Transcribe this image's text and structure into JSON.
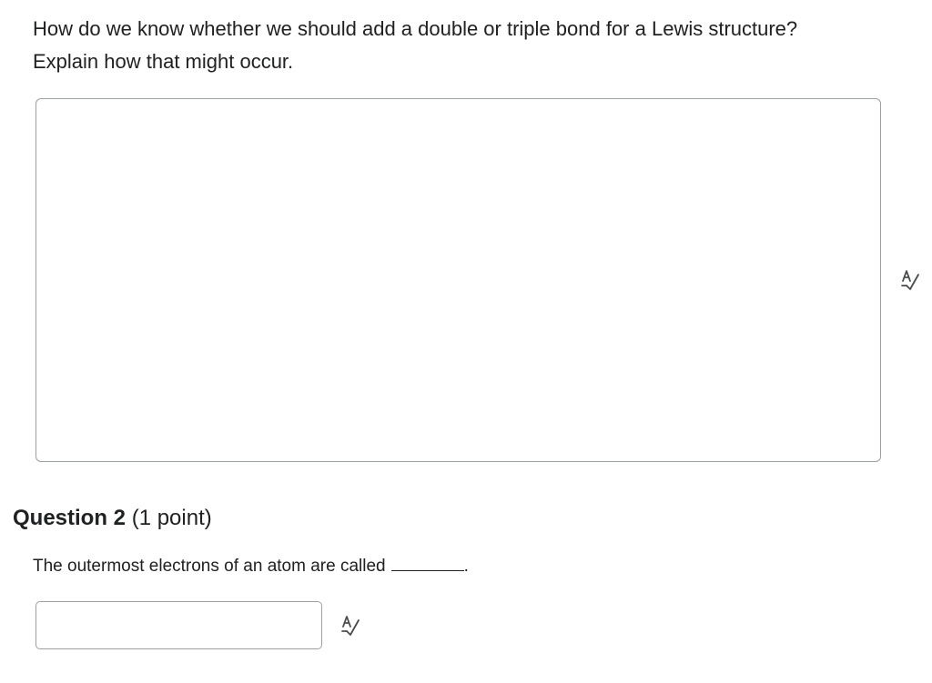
{
  "question1": {
    "prompt": "How do we know whether we should add a double or triple bond for a Lewis structure? Explain how that might occur.",
    "answer_value": ""
  },
  "question2": {
    "heading_label": "Question 2",
    "points_label": "(1 point)",
    "prompt": "The outermost electrons of an atom are called",
    "prompt_end": ".",
    "answer_value": ""
  },
  "icons": {
    "spellcheck": "spellcheck-icon"
  },
  "colors": {
    "text": "#202122",
    "border": "#9c9fa3",
    "icon": "#494c4e"
  }
}
